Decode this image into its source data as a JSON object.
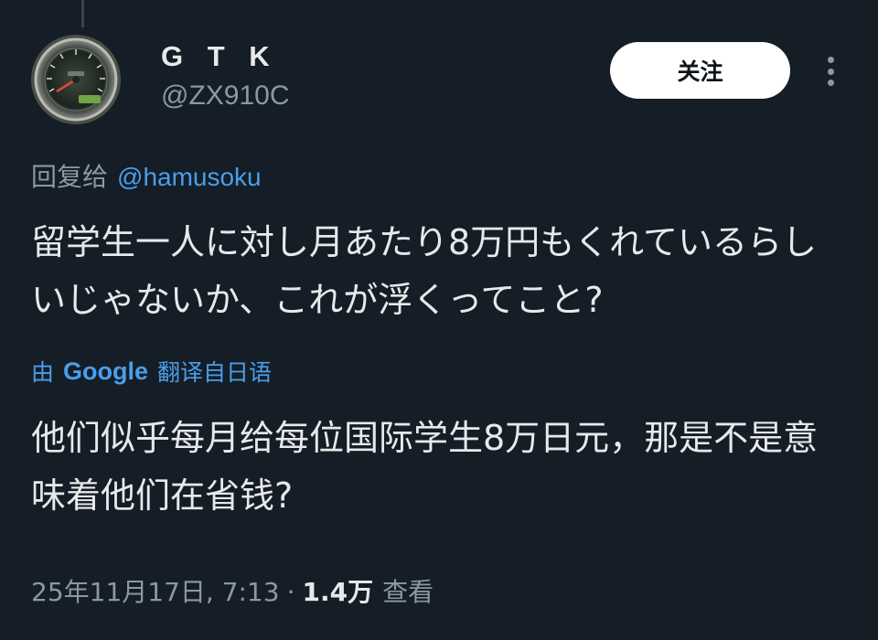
{
  "author": {
    "display_name": "G T K",
    "handle": "@ZX910C",
    "avatar_icon": "speedometer-avatar"
  },
  "follow_button": {
    "label": "关注"
  },
  "more_menu": {
    "icon": "more-vertical-icon"
  },
  "reply_context": {
    "prefix": "回复给",
    "mention": "@hamusoku"
  },
  "tweet": {
    "text": "留学生一人に対し月あたり8万円もくれているらしいじゃないか、これが浮くってこと?"
  },
  "translation": {
    "prefix": "由",
    "provider": "Google",
    "from_label": "翻译自日语",
    "text": "他们似乎每月给每位国际学生8万日元，那是不是意味着他们在省钱?"
  },
  "meta": {
    "timestamp": "25年11月17日, 7:13",
    "separator": "·",
    "views_count": "1.4万",
    "views_label": "查看"
  },
  "colors": {
    "background": "#151d27",
    "text_primary": "#e7e9ea",
    "text_secondary": "#8b98a5",
    "link": "#4a9eea",
    "follow_bg": "#ffffff"
  }
}
